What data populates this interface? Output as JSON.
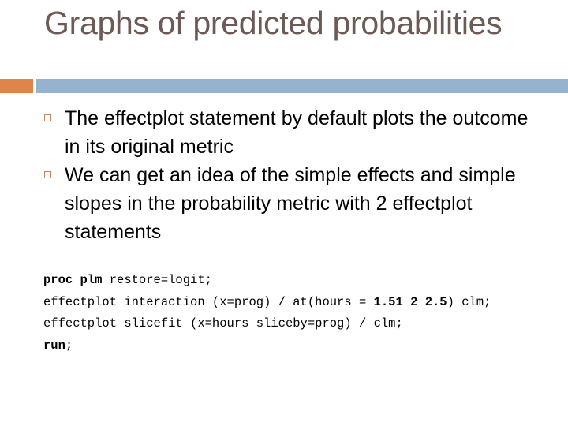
{
  "slide": {
    "title": "Graphs of predicted probabilities",
    "accent_colors": {
      "orange": "#df854c",
      "blue": "#95b3cf",
      "title_text": "#6b5a55",
      "bullet": "#c8845a"
    },
    "bullets": [
      {
        "icon": "hollow-square-bullet-icon",
        "text": "The effectplot statement by default plots the outcome in its original metric"
      },
      {
        "icon": "hollow-square-bullet-icon",
        "text": "We can get an idea of the simple effects and simple slopes in the probability metric with 2 effectplot statements"
      }
    ],
    "code": {
      "line1": {
        "bold": "proc plm",
        "rest": " restore=logit;"
      },
      "line2": {
        "pre": "effectplot interaction (x=prog) / at(hours = ",
        "bold": "1.51 2 2.5",
        "post": ") clm;"
      },
      "line3": {
        "text": "effectplot slicefit (x=hours sliceby=prog) / clm;"
      },
      "line4": {
        "bold": "run",
        "rest": ";"
      }
    }
  }
}
